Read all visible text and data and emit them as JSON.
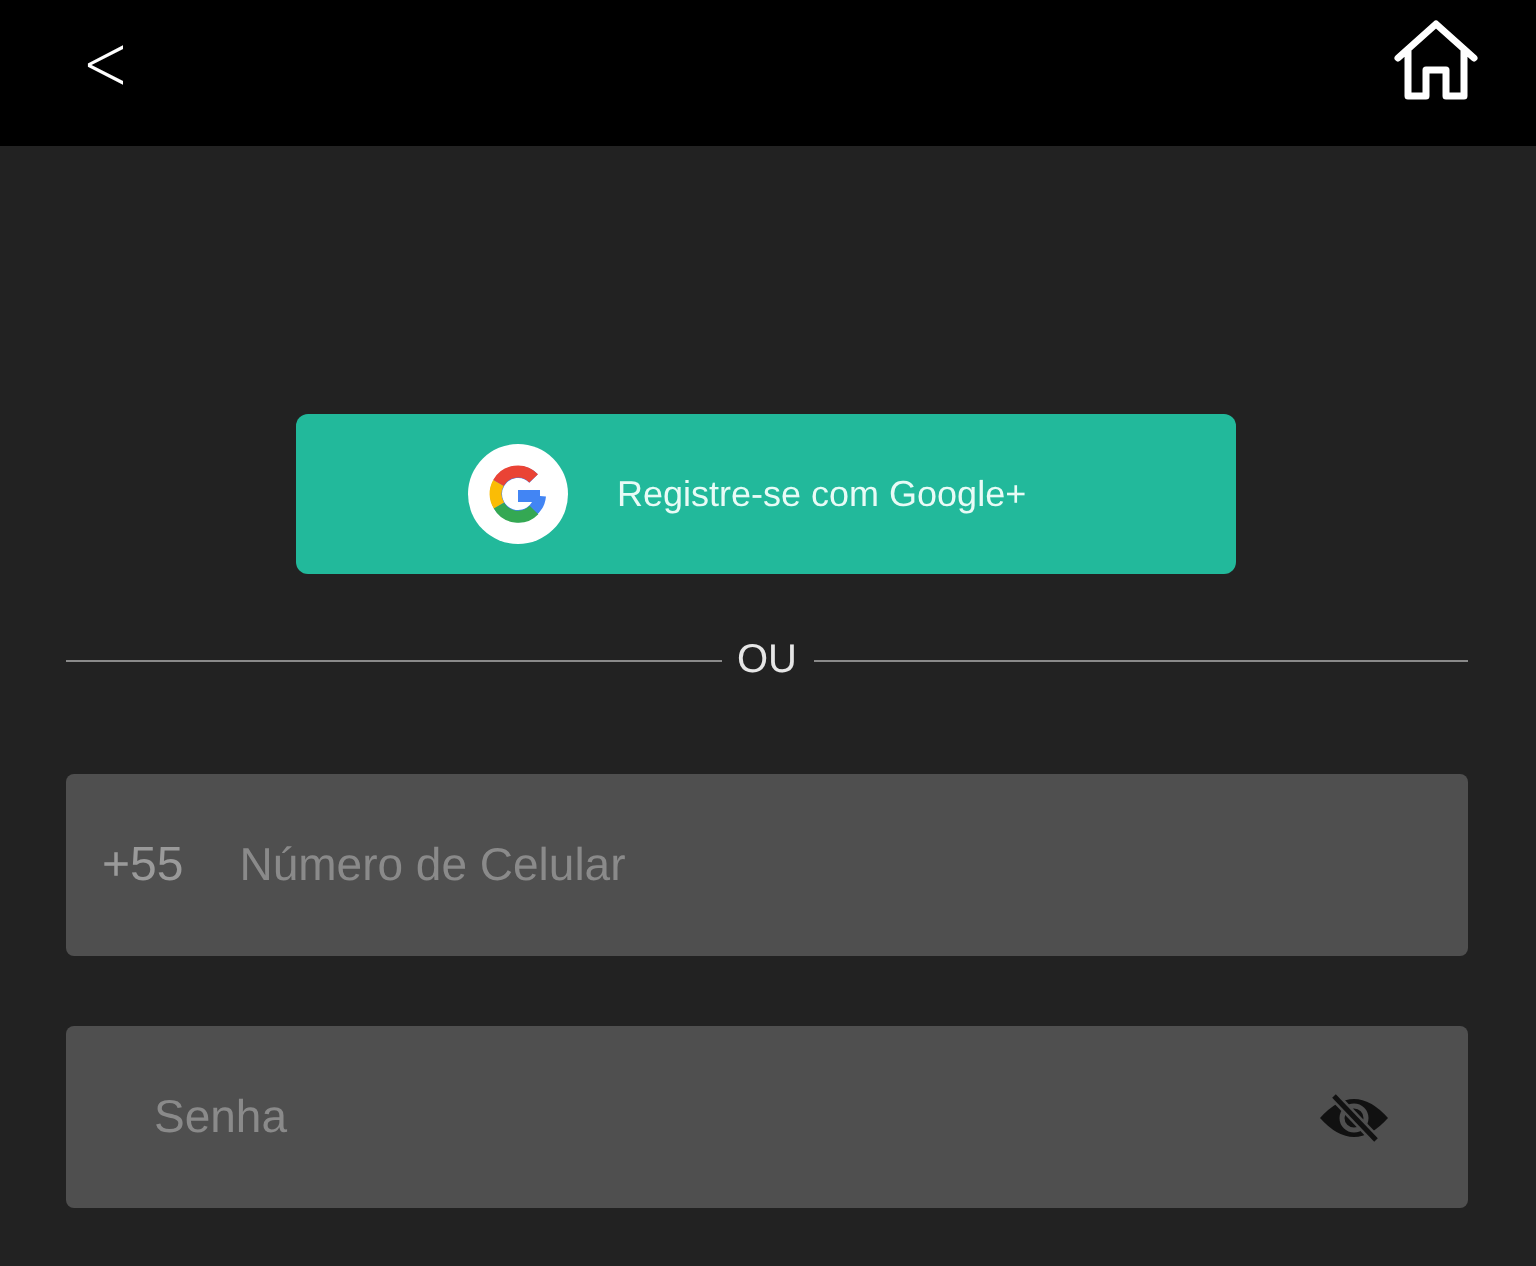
{
  "header": {
    "back": "<"
  },
  "google_button": {
    "label": "Registre-se com Google+"
  },
  "divider": {
    "label": "OU"
  },
  "phone_field": {
    "prefix": "+55",
    "placeholder": "Número de Celular"
  },
  "password_field": {
    "placeholder": "Senha",
    "password_visible": false
  }
}
